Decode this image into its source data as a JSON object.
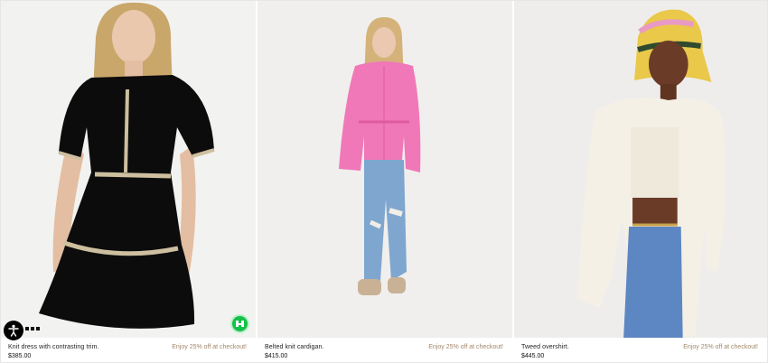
{
  "products": [
    {
      "name": "Knit dress with contrasting trim.",
      "price": "$385.00",
      "promo": "Enjoy 25% off at checkout!",
      "image_alt": "Black knit dress with contrasting trim"
    },
    {
      "name": "Belted knit cardigan.",
      "price": "$415.00",
      "promo": "Enjoy 25% off at checkout!",
      "image_alt": "Pink belted knit cardigan"
    },
    {
      "name": "Tweed overshirt.",
      "price": "$445.00",
      "promo": "Enjoy 25% off at checkout!",
      "image_alt": "White tweed overshirt"
    }
  ],
  "accessibility": {
    "icon": "accessibility-icon"
  },
  "badge": {
    "icon": "shop-badge-icon"
  },
  "colors": {
    "promo": "#a3876a",
    "badge": "#16c04a",
    "background": "#f1f1f1"
  }
}
